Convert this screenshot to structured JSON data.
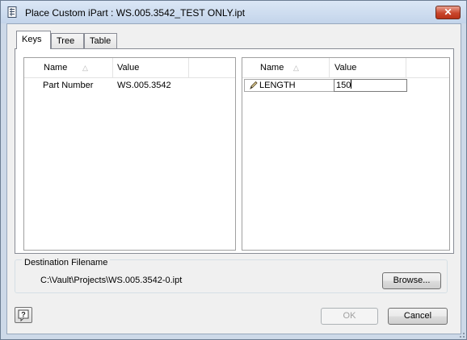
{
  "window": {
    "title": "Place Custom iPart : WS.005.3542_TEST ONLY.ipt",
    "close_glyph": "✕"
  },
  "tabs": [
    {
      "label": "Keys",
      "active": true
    },
    {
      "label": "Tree",
      "active": false
    },
    {
      "label": "Table",
      "active": false
    }
  ],
  "left_grid": {
    "columns": [
      "Name",
      "Value"
    ],
    "rows": [
      {
        "name": "Part Number",
        "value": "WS.005.3542"
      }
    ]
  },
  "right_grid": {
    "columns": [
      "Name",
      "Value"
    ],
    "rows": [
      {
        "name": "LENGTH",
        "value": "150",
        "editing": true
      }
    ]
  },
  "destination": {
    "label": "Destination Filename",
    "path": "C:\\Vault\\Projects\\WS.005.3542-0.ipt",
    "browse_label": "Browse..."
  },
  "footer": {
    "ok_label": "OK",
    "cancel_label": "Cancel",
    "ok_enabled": false
  },
  "icons": {
    "title_icon": "ipart-table-icon",
    "help_icon": "help-icon",
    "edit_icon": "pencil-icon"
  }
}
